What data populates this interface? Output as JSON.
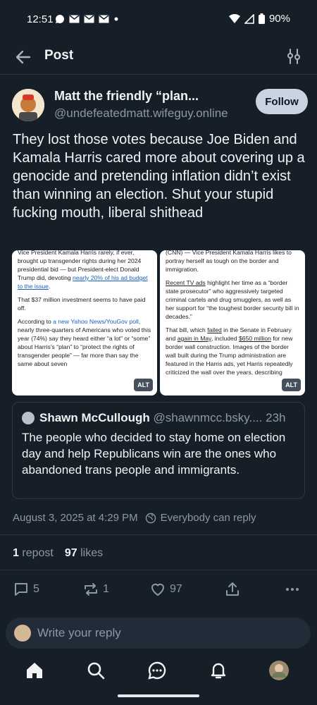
{
  "status_bar": {
    "time": "12:51",
    "battery": "90%"
  },
  "header": {
    "title": "Post"
  },
  "post": {
    "author_name": "Matt the friendly “plan...",
    "author_handle": "@undefeatedmatt.wifeguy.online",
    "follow_label": "Follow",
    "text": "They lost those votes because Joe Biden and Kamala Harris cared more about covering up a genocide and pretending inflation didn’t exist than winning an election. Shut your stupid fucking mouth, liberal shithead",
    "images": [
      {
        "alt_label": "ALT",
        "p1_a": "Vice President Kamala Harris rarely, if ever, brought up transgender rights during her 2024 presidential bid — but President-elect Donald Trump did, devoting ",
        "p1_link": "nearly 20% of his ad budget to the issue",
        "p1_end": ".",
        "p2": "That $37 million investment seems to have paid off.",
        "p3_a": "According to ",
        "p3_link": "a new Yahoo News/YouGov poll",
        "p3_b": ", nearly three-quarters of Americans who voted this year (74%) say they heard either “a lot” or “some” about Harris’s “plan” to “protect the rights of transgender people” — far more than say the same about seven"
      },
      {
        "alt_label": "ALT",
        "p1": "(CNN) — Vice President Kamala Harris likes to portray herself as tough on the border and immigration.",
        "p2_link": "Recent TV ads",
        "p2_b": " highlight her time as a “border state prosecutor” who aggressively targeted criminal cartels and drug smugglers, as well as her support for “the toughest border security bill in decades.”",
        "p3_a": "That bill, which ",
        "p3_link1": "failed",
        "p3_b": " in the Senate in February and ",
        "p3_link2": "again in May",
        "p3_c": ", included ",
        "p3_link3": "$650 million",
        "p3_d": " for new border wall construction. Images of the border wall built during the Trump administration are featured in the Harris ads, yet Harris repeatedly criticized the wall over the years, describing"
      }
    ],
    "quote": {
      "name": "Shawn McCullough",
      "handle": "@shawnmcc.bsky....",
      "time": "23h",
      "text": "The people who decided to stay home on election day and help Republicans win are the ones who abandoned trans people and immigrants."
    },
    "date": "August 3, 2025 at 4:29 PM",
    "reply_setting": "Everybody can reply",
    "reposts_count": "1",
    "reposts_label": "repost",
    "likes_count": "97",
    "likes_label": "likes",
    "action_counts": {
      "replies": "5",
      "reposts": "1",
      "likes": "97"
    }
  },
  "reply_placeholder": "Write your reply",
  "icons": {
    "back": "arrow-left-icon",
    "filter": "sliders-icon",
    "reply": "comment-icon",
    "repost": "repost-icon",
    "like": "heart-icon",
    "share": "share-icon",
    "more": "more-icon",
    "home": "home-icon",
    "search": "search-icon",
    "chat": "chat-icon",
    "notifications": "bell-icon"
  },
  "colors": {
    "background": "#161e27",
    "accent": "#1a5fc1",
    "muted": "#8b98a8"
  }
}
